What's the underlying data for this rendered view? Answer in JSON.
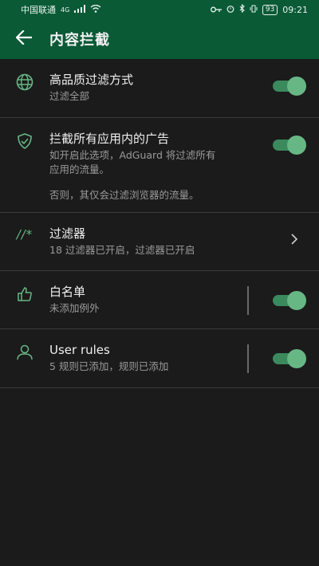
{
  "status_bar": {
    "carrier": "中国联通",
    "network": "4G",
    "battery": "93",
    "time": "09:21"
  },
  "toolbar": {
    "title": "内容拦截"
  },
  "items": [
    {
      "title": "高品质过滤方式",
      "subtitle": "过滤全部",
      "icon": "globe-icon",
      "toggle_on": true
    },
    {
      "title": "拦截所有应用内的广告",
      "subtitle": "如开启此选项，AdGuard 将过滤所有应用的流量。",
      "subtitle_line1": "如开启此选项，AdGuard 将过滤所有",
      "subtitle_line2": "应用的流量。",
      "note": "否则，其仅会过滤浏览器的流量。",
      "icon": "shield-check-icon",
      "toggle_on": true
    },
    {
      "title": "过滤器",
      "subtitle": "18 过滤器已开启，过滤器已开启",
      "icon": "filter-rules-icon"
    },
    {
      "title": "白名单",
      "subtitle": "未添加例外",
      "icon": "thumbs-up-icon",
      "toggle_on": true
    },
    {
      "title": "User rules",
      "subtitle": "5 规则已添加，规则已添加",
      "icon": "user-icon",
      "toggle_on": true
    }
  ],
  "colors": {
    "header": "#0a5a36",
    "accent": "#67b785",
    "background": "#1b1b1b"
  }
}
